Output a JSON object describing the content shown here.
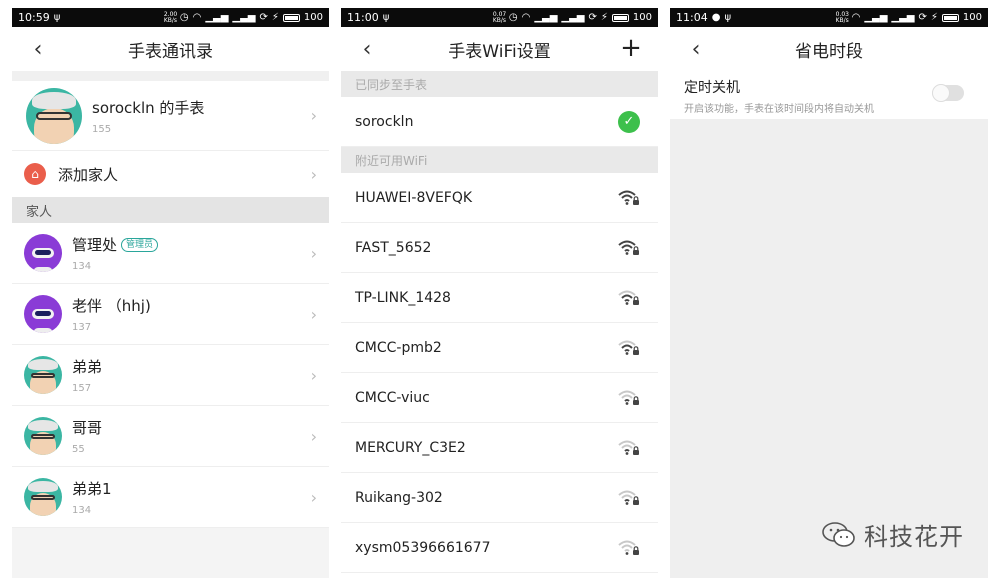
{
  "panel1": {
    "status": {
      "time": "10:59",
      "left_icon": "usb-icon",
      "mini": "2.00 KB/s",
      "battery": "100"
    },
    "title": "手表通讯录",
    "owner": {
      "name": "sorockln 的手表",
      "sub": "155"
    },
    "add_family": "添加家人",
    "section_family": "家人",
    "contacts": [
      {
        "name": "管理处",
        "badge": "管理员",
        "sub": "134",
        "avatar": "robot"
      },
      {
        "name": "老伴 （hhj)",
        "badge": "",
        "sub": "137",
        "avatar": "robot"
      },
      {
        "name": "弟弟",
        "badge": "",
        "sub": "157",
        "avatar": "grandpa"
      },
      {
        "name": "哥哥",
        "badge": "",
        "sub": "55",
        "avatar": "grandpa"
      },
      {
        "name": "弟弟1",
        "badge": "",
        "sub": "134",
        "avatar": "grandpa"
      }
    ]
  },
  "panel2": {
    "status": {
      "time": "11:00",
      "left_icon": "usb-icon",
      "mini": "0.07 KB/s",
      "battery": "100"
    },
    "title": "手表WiFi设置",
    "synced_header": "已同步至手表",
    "synced": "sorockln",
    "nearby_header": "附近可用WiFi",
    "networks": [
      {
        "ssid": "HUAWEI-8VEFQK",
        "strength": 0.9
      },
      {
        "ssid": "FAST_5652",
        "strength": 0.9
      },
      {
        "ssid": "TP-LINK_1428",
        "strength": 0.6
      },
      {
        "ssid": "CMCC-pmb2",
        "strength": 0.6
      },
      {
        "ssid": "CMCC-viuc",
        "strength": 0.4
      },
      {
        "ssid": "MERCURY_C3E2",
        "strength": 0.3
      },
      {
        "ssid": "Ruikang-302",
        "strength": 0.3
      },
      {
        "ssid": "xysm05396661677",
        "strength": 0.2
      }
    ]
  },
  "panel3": {
    "status": {
      "time": "11:04",
      "left_icon": "message-icon",
      "mini": "0.03 KB/s",
      "battery": "100"
    },
    "title": "省电时段",
    "timer_title": "定时关机",
    "timer_desc": "开启该功能，手表在该时间段内将自动关机",
    "toggle_on": false
  },
  "watermark": "科技花开"
}
